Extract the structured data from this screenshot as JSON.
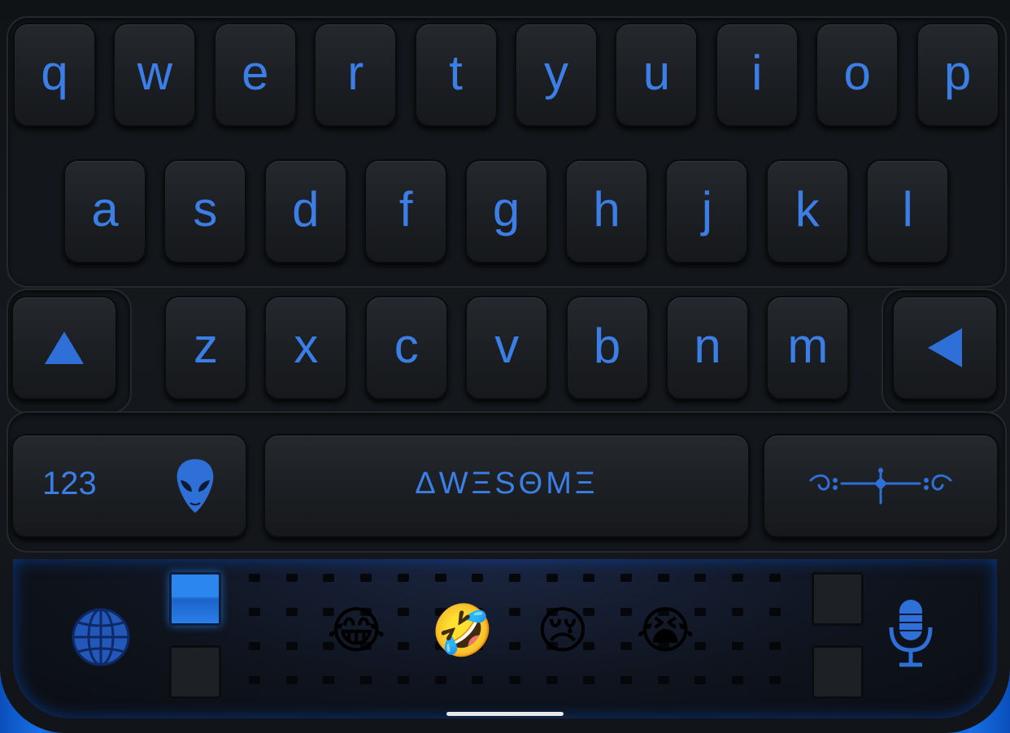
{
  "keyboard": {
    "row1": [
      "q",
      "w",
      "e",
      "r",
      "t",
      "y",
      "u",
      "i",
      "o",
      "p"
    ],
    "row2": [
      "a",
      "s",
      "d",
      "f",
      "g",
      "h",
      "j",
      "k",
      "l"
    ],
    "row3": [
      "z",
      "x",
      "c",
      "v",
      "b",
      "n",
      "m"
    ],
    "numbers_label": "123",
    "space_label": "ΔWΞSΘMΞ",
    "emojis": [
      "😂",
      "🤣",
      "😢",
      "😭"
    ]
  },
  "colors": {
    "accent": "#3b7ee6",
    "key_bg": "#1c1f23",
    "bottom_blue": "#1a6ad8"
  },
  "icons": {
    "shift": "shift-up-triangle-icon",
    "backspace": "backspace-left-triangle-icon",
    "alien": "alien-head-icon",
    "return": "ornamental-return-icon",
    "globe": "globe-icon",
    "mic": "microphone-icon"
  }
}
